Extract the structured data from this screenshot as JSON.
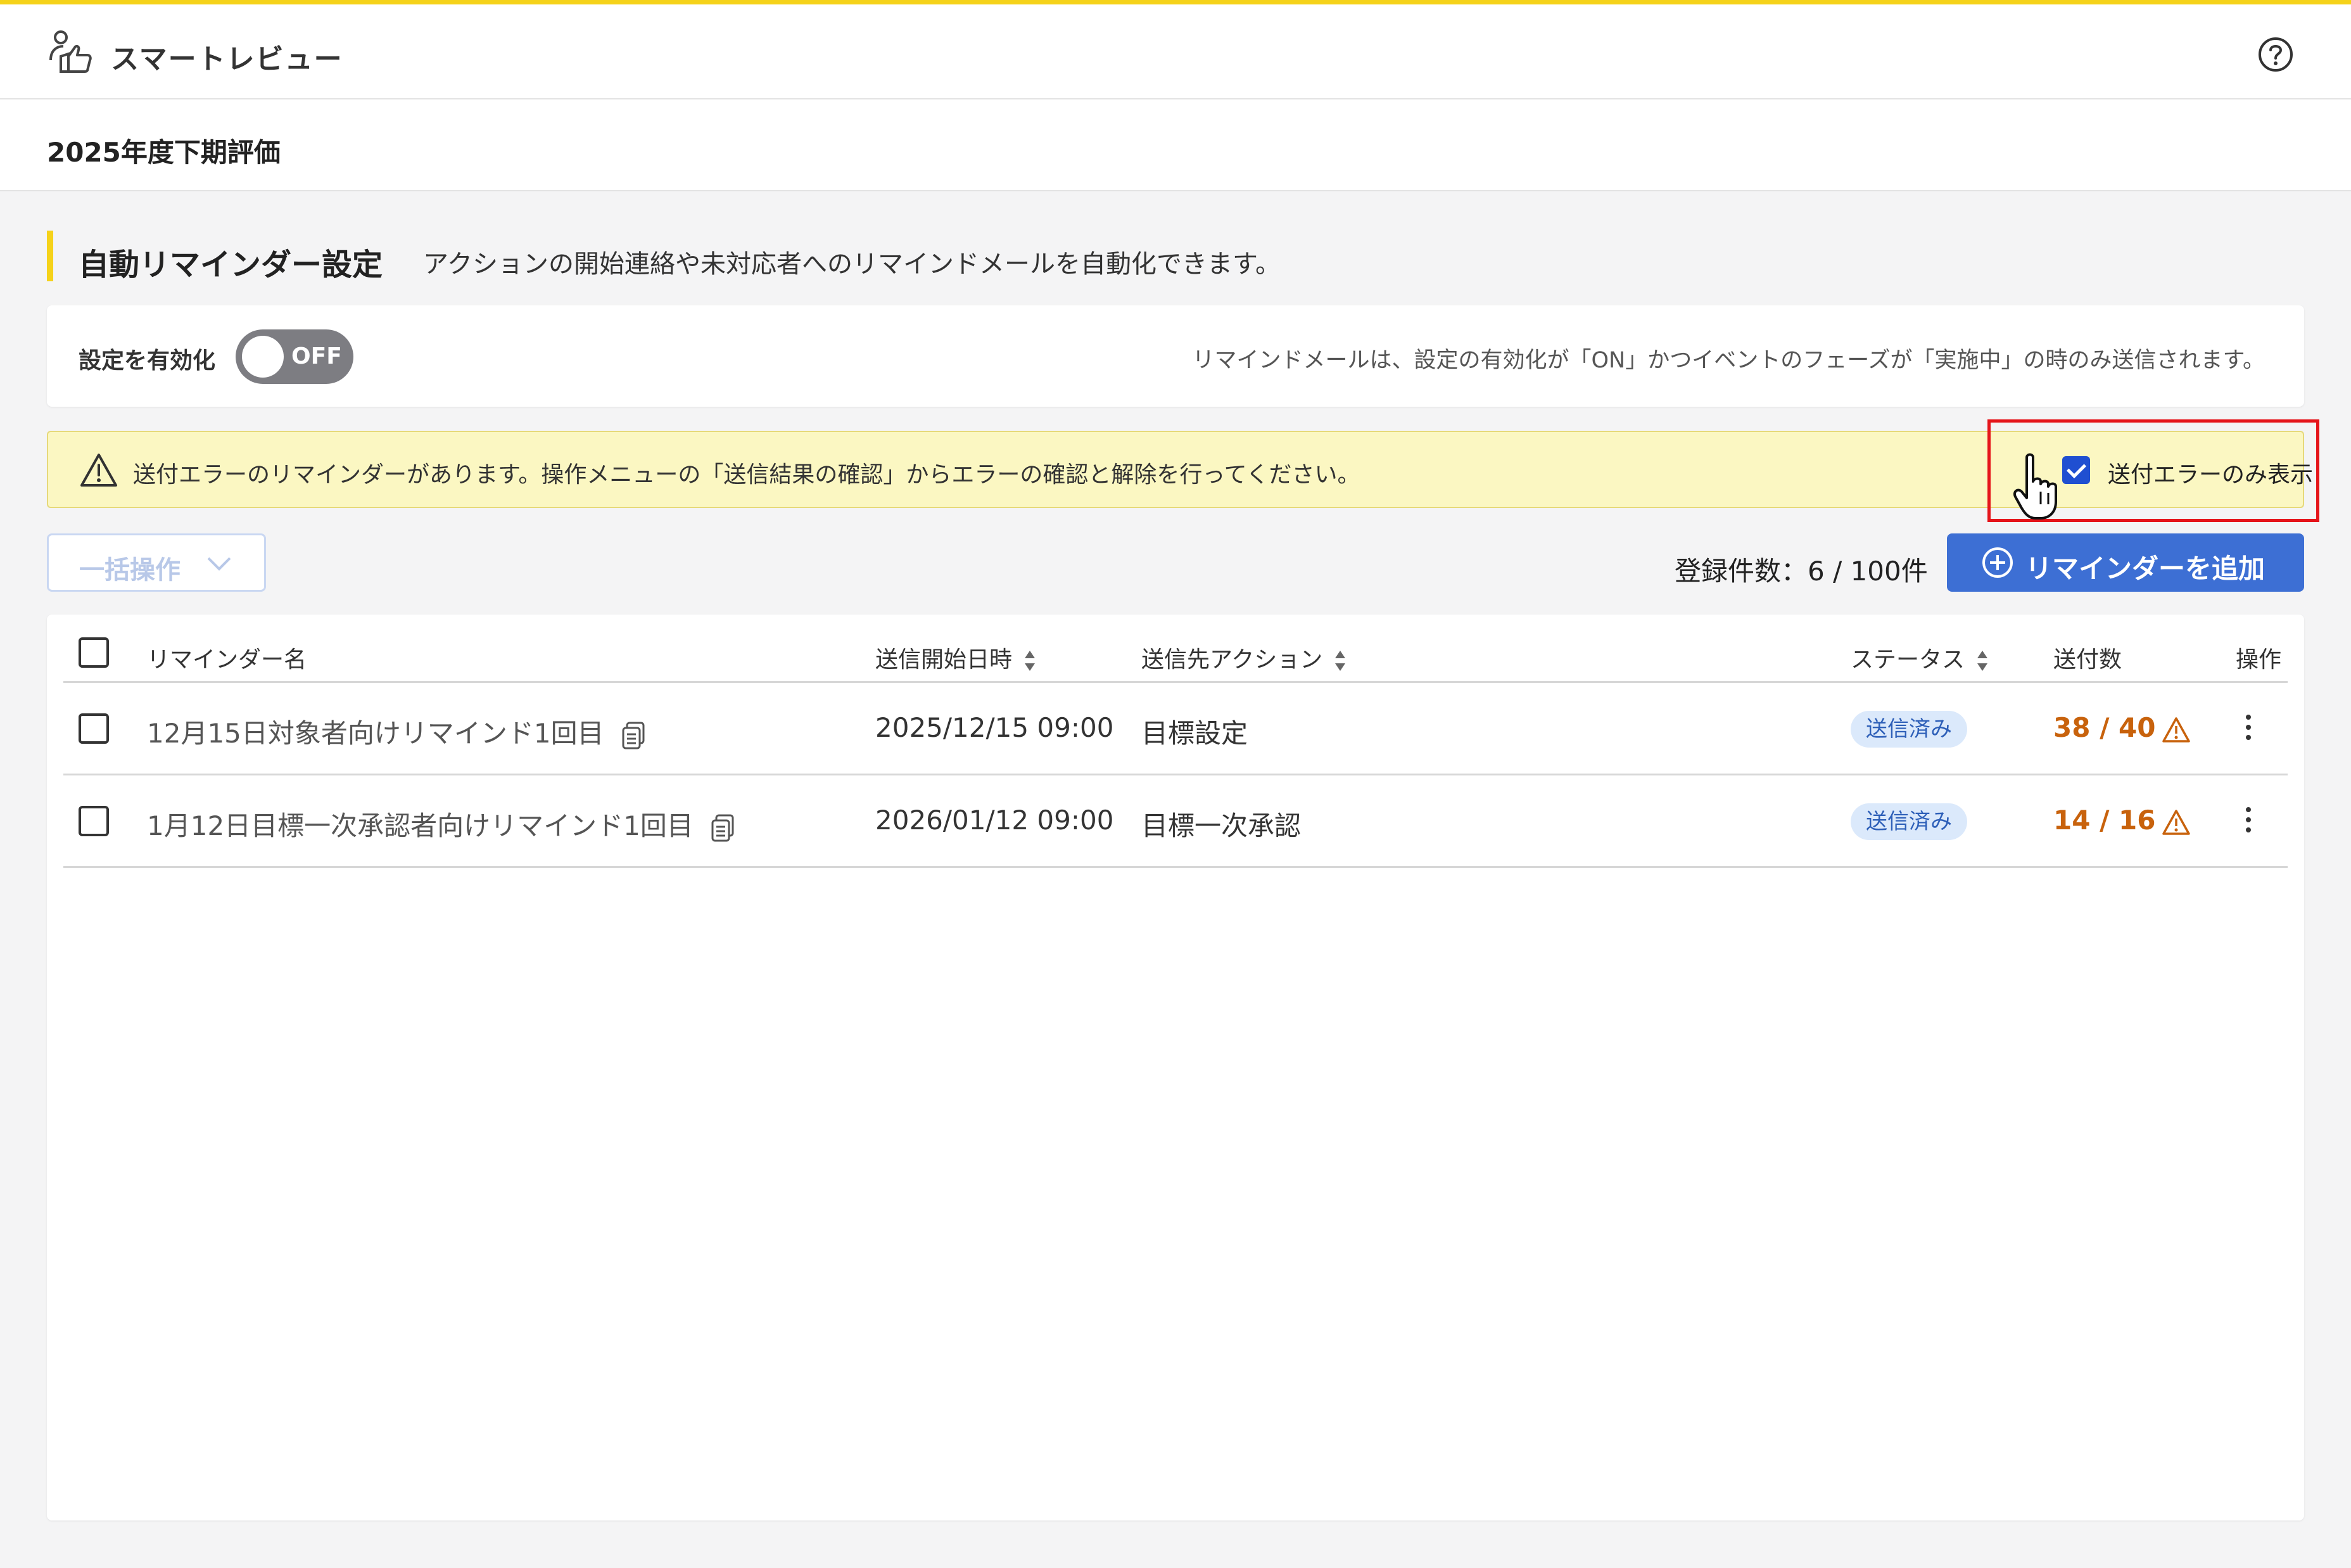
{
  "header": {
    "app_title": "スマートレビュー",
    "app_icon": "reviewer-thumbs-up-icon",
    "help_icon": "help-circle-icon"
  },
  "subheader": {
    "title": "2025年度下期評価"
  },
  "section": {
    "title": "自動リマインダー設定",
    "description": "アクションの開始連絡や未対応者へのリマインドメールを自動化できます。"
  },
  "settings": {
    "enable_label": "設定を有効化",
    "toggle_text": "OFF",
    "toggle_state": "off",
    "note": "リマインドメールは、設定の有効化が「ON」かつイベントのフェーズが「実施中」の時のみ送信されます。"
  },
  "alert": {
    "text": "送付エラーのリマインダーがあります。操作メニューの「送信結果の確認」からエラーの確認と解除を行ってください。",
    "filter_label": "送付エラーのみ表示",
    "filter_checked": true
  },
  "toolbar": {
    "bulk_label": "一括操作",
    "count_text": "登録件数：6 / 100件",
    "add_label": "リマインダーを追加"
  },
  "table": {
    "columns": {
      "name": "リマインダー名",
      "start": "送信開始日時",
      "action": "送信先アクション",
      "status": "ステータス",
      "sent": "送付数",
      "ops": "操作"
    },
    "rows": [
      {
        "name": "12月15日対象者向けリマインド1回目",
        "start": "2025/12/15 09:00",
        "action": "目標設定",
        "status": "送信済み",
        "sent": "38 / 40"
      },
      {
        "name": "1月12日目標一次承認者向けリマインド1回目",
        "start": "2026/01/12 09:00",
        "action": "目標一次承認",
        "status": "送信済み",
        "sent": "14 / 16"
      }
    ]
  },
  "colors": {
    "accent_yellow": "#f5d21a",
    "primary_blue": "#3d6fd4",
    "error_orange": "#c8620c",
    "highlight_red": "#e5141a"
  }
}
